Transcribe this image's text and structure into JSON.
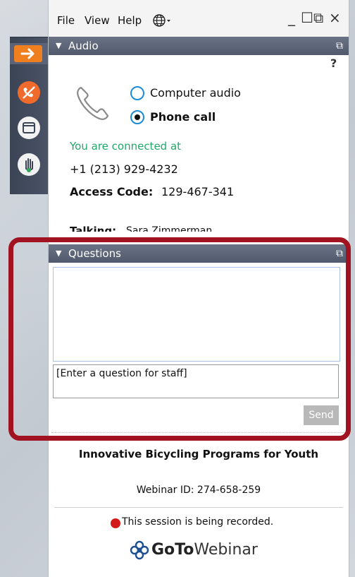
{
  "menu": {
    "file": "File",
    "view": "View",
    "help": "Help"
  },
  "window_controls": {
    "minimize": "_",
    "maximize": "☐",
    "popout": "⧉",
    "close": "×"
  },
  "audio": {
    "header": "Audio",
    "help_icon_label": "?",
    "options": [
      {
        "label": "Computer audio",
        "selected": false
      },
      {
        "label": "Phone call",
        "selected": true
      }
    ],
    "connected_text": "You are connected at",
    "phone_number": "+1 (213) 929-4232",
    "access_code_label": "Access Code:",
    "access_code": "129-467-341",
    "talking_label": "Talking:",
    "talking_name": "Sara Zimmerman"
  },
  "questions": {
    "header": "Questions",
    "input_placeholder": "[Enter a question for staff]",
    "send_label": "Send"
  },
  "webinar": {
    "title": "Innovative Bicycling Programs for Youth",
    "id_text": "Webinar ID: 274-658-259",
    "recording_text": "This session is being recorded."
  },
  "brand": {
    "logo_bold": "GoTo",
    "logo_regular": "Webinar"
  },
  "colors": {
    "accent": "#1a8bd6",
    "connected": "#22a86a",
    "highlight": "#a11320",
    "record": "#d21a1a"
  },
  "icons": {
    "toolbar": [
      "arrow-right-icon",
      "phone-hangup-icon",
      "window-icon",
      "raise-hand-icon"
    ],
    "menu": "globe-icon"
  }
}
